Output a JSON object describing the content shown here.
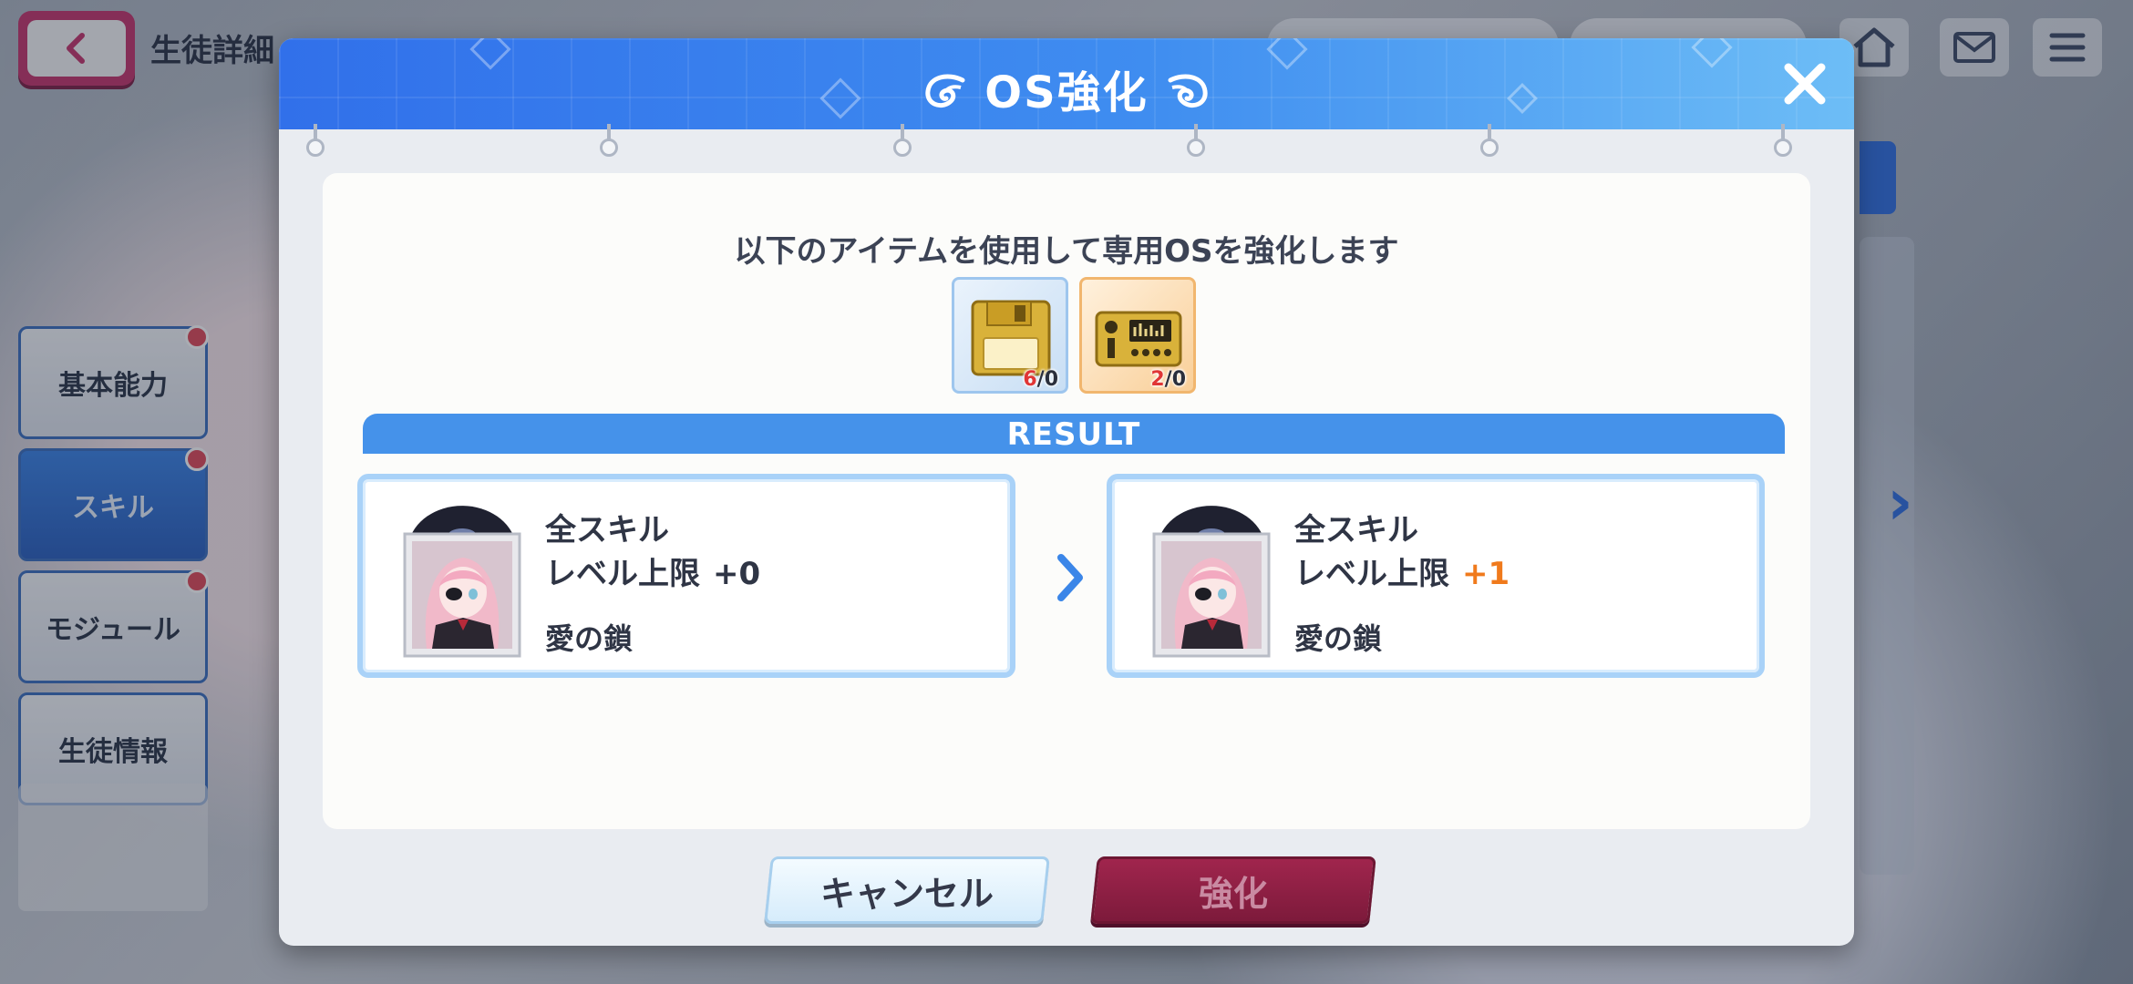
{
  "background": {
    "screen_title": "生徒詳細",
    "side_tabs": [
      {
        "label": "基本能力",
        "active": false,
        "badge": true
      },
      {
        "label": "スキル",
        "active": true,
        "badge": true
      },
      {
        "label": "モジュール",
        "active": false,
        "badge": true
      },
      {
        "label": "生徒情報",
        "active": false,
        "badge": false
      }
    ],
    "top_icons": [
      "home-icon",
      "mail-icon",
      "menu-icon"
    ]
  },
  "dialog": {
    "title": "OS強化",
    "close_icon": "close-icon",
    "instruction": "以下のアイテムを使用して専用OSを強化します",
    "items": [
      {
        "name": "floppy-disk-item-icon",
        "have": "6",
        "need": "/0",
        "frame": "blue"
      },
      {
        "name": "control-board-item-icon",
        "have": "2",
        "need": "/0",
        "frame": "orange"
      }
    ],
    "result_label": "RESULT",
    "before": {
      "line1": "全スキル",
      "line2": "レベル上限",
      "value": "+0",
      "os_name": "愛の鎖"
    },
    "after": {
      "line1": "全スキル",
      "line2": "レベル上限",
      "value": "+1",
      "os_name": "愛の鎖"
    },
    "cancel_label": "キャンセル",
    "enhance_label": "強化",
    "colors": {
      "header_start": "#3170ea",
      "header_end": "#6dbdf6",
      "result_bar": "#4592ea",
      "increase": "#f07a1c",
      "enhance_button": "#8a1f43"
    }
  }
}
